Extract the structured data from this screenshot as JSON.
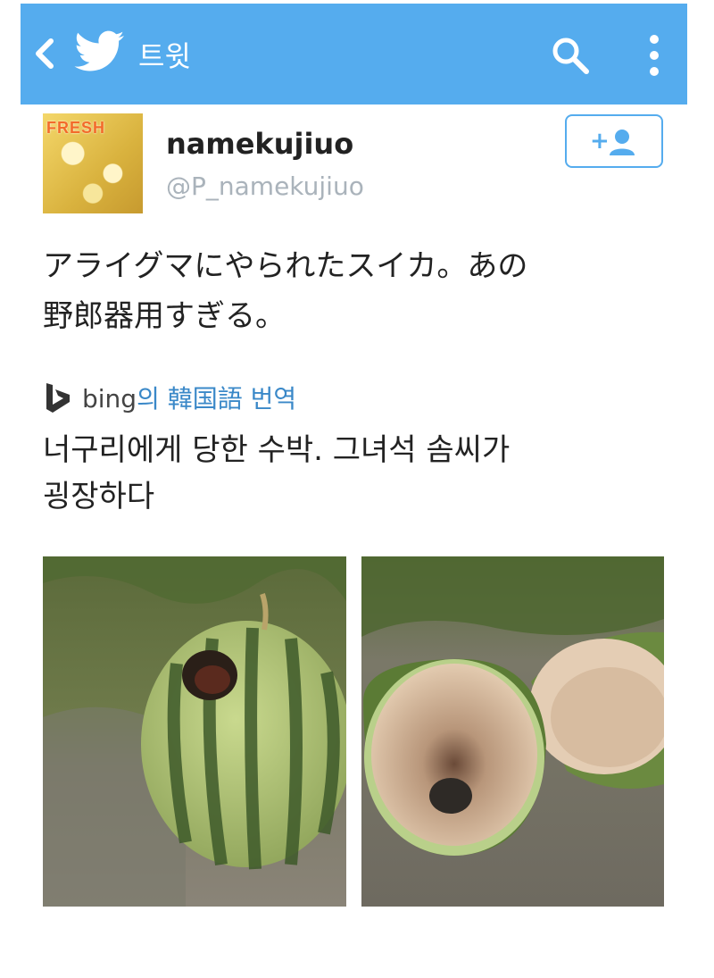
{
  "header": {
    "title": "트윗",
    "back_icon": "back-chevron-icon",
    "logo_icon": "twitter-bird-icon",
    "search_icon": "search-icon",
    "menu_icon": "more-vertical-icon"
  },
  "user": {
    "display_name": "namekujiuo",
    "handle": "@P_namekujiuo",
    "avatar_text": "FRESH"
  },
  "follow_button": {
    "icon": "add-user-icon",
    "label": "+"
  },
  "tweet": {
    "text_line1": "アライグマにやられたスイカ。あの",
    "text_line2": "野郎器用すぎる。"
  },
  "translation": {
    "provider": "bing",
    "label_rest": "의 韓国語 번역",
    "text_line1": "너구리에게 당한 수박. 그녀석 솜씨가",
    "text_line2": "굉장하다"
  },
  "media": {
    "photo_count": 2
  },
  "colors": {
    "accent": "#55acee",
    "link": "#3a88c8",
    "muted": "#aab3bb"
  }
}
